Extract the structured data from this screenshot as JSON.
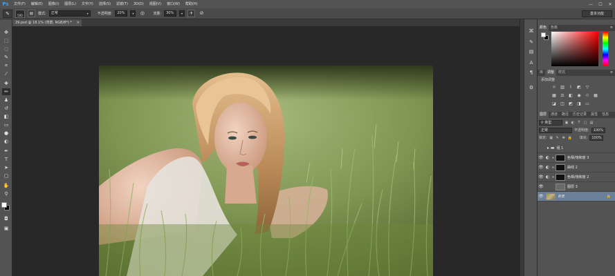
{
  "app": {
    "logo": "Ps",
    "menu": [
      "文件(F)",
      "编辑(E)",
      "图像(I)",
      "图层(L)",
      "文字(Y)",
      "选择(S)",
      "滤镜(T)",
      "3D(D)",
      "视图(V)",
      "窗口(W)",
      "帮助(H)"
    ],
    "window_controls": [
      "—",
      "☐",
      "✕"
    ],
    "workspace": "基本功能"
  },
  "options": {
    "brush_size": "500",
    "mode_label": "模式:",
    "mode_value": "正常",
    "opacity_label": "不透明度:",
    "opacity_value": "20%",
    "flow_label": "流量:",
    "flow_value": "30%"
  },
  "document": {
    "tab_title": "29.psd @ 18.1% (背景, RGB/8*) *",
    "close": "×"
  },
  "panels": {
    "color_tabs": [
      "颜色",
      "色板"
    ],
    "adjust_tabs": [
      "库",
      "调整",
      "样式"
    ],
    "adjust_title": "添加调整",
    "layer_tabs": [
      "图层",
      "通道",
      "路径",
      "历史记录",
      "属性",
      "信息"
    ],
    "kind_filter": "类型",
    "blend_mode": "正常",
    "opacity_label": "不透明度:",
    "opacity_value": "100%",
    "lock_label": "锁定:",
    "fill_label": "填充:",
    "fill_value": "100%",
    "menu_icon": "≡"
  },
  "layers": [
    {
      "name": "组 1",
      "type": "group",
      "visible": false
    },
    {
      "name": "色相/饱和度 3",
      "type": "adjustment",
      "visible": true
    },
    {
      "name": "曲线 2",
      "type": "adjustment",
      "visible": true
    },
    {
      "name": "色相/饱和度 2",
      "type": "adjustment",
      "visible": true
    },
    {
      "name": "图层 3",
      "type": "pixel",
      "visible": true
    },
    {
      "name": "背景",
      "type": "background",
      "visible": true,
      "selected": true
    }
  ],
  "colors": {
    "accent": "#3ba0ff",
    "chrome": "#535353",
    "canvas_bg": "#282828",
    "selected_layer": "#6b7f99"
  }
}
